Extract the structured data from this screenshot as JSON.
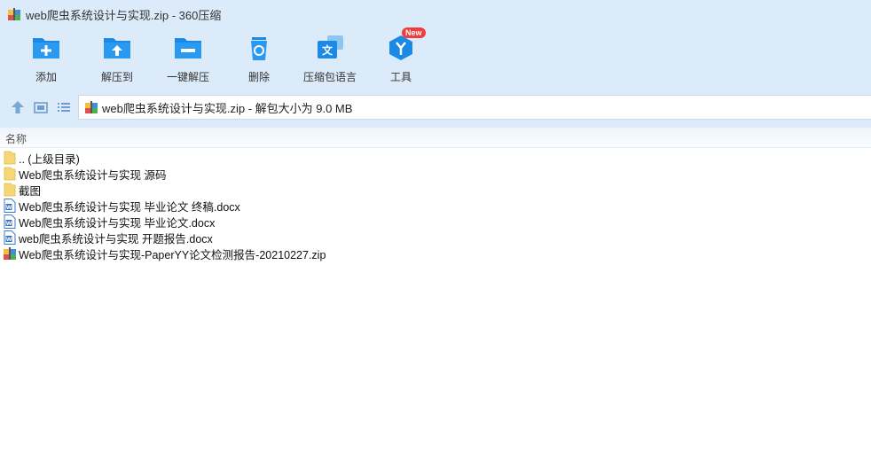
{
  "window": {
    "title": "web爬虫系统设计与实现.zip - 360压缩"
  },
  "toolbar": {
    "items": [
      {
        "label": "添加",
        "icon": "add-folder-icon"
      },
      {
        "label": "解压到",
        "icon": "extract-to-icon"
      },
      {
        "label": "一键解压",
        "icon": "one-click-extract-icon"
      },
      {
        "label": "删除",
        "icon": "delete-icon"
      },
      {
        "label": "压缩包语言",
        "icon": "archive-language-icon"
      },
      {
        "label": "工具",
        "icon": "tools-icon",
        "badge": "New"
      }
    ]
  },
  "address": {
    "text": "web爬虫系统设计与实现.zip - 解包大小为 9.0 MB"
  },
  "list": {
    "header": "名称",
    "items": [
      {
        "name": ".. (上级目录)",
        "type": "folder"
      },
      {
        "name": "Web爬虫系统设计与实现 源码",
        "type": "folder"
      },
      {
        "name": "截图",
        "type": "folder"
      },
      {
        "name": "Web爬虫系统设计与实现 毕业论文 终稿.docx",
        "type": "docx"
      },
      {
        "name": "Web爬虫系统设计与实现 毕业论文.docx",
        "type": "docx"
      },
      {
        "name": "web爬虫系统设计与实现 开题报告.docx",
        "type": "docx"
      },
      {
        "name": "Web爬虫系统设计与实现-PaperYY论文检测报告-20210227.zip",
        "type": "zip"
      }
    ]
  },
  "colors": {
    "accent": "#1a8ae6",
    "chrome": "#dcebfa",
    "folder": "#f7d774",
    "badge": "#f23b3b"
  }
}
